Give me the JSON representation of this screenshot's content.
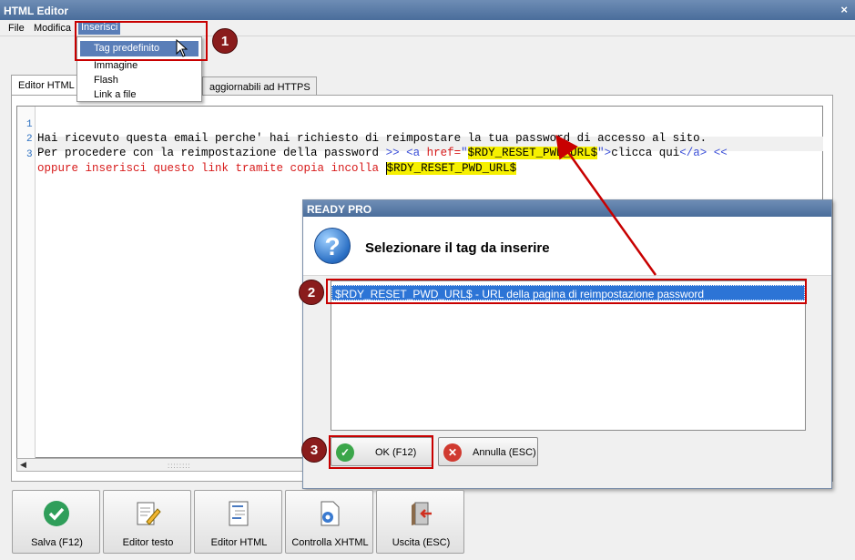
{
  "window": {
    "title": "HTML Editor",
    "close": "×"
  },
  "menubar": {
    "file": "File",
    "modifica": "Modifica",
    "inserisci": "Inserisci"
  },
  "dropdown": {
    "items": [
      "Tag predefinito",
      "Immagine",
      "Flash",
      "Link a file"
    ]
  },
  "tabs": {
    "editor_html": "Editor HTML",
    "partial": "aggiornabili ad HTTPS"
  },
  "code": {
    "line_numbers": [
      "1",
      "2",
      "3"
    ],
    "line1": "Hai ricevuto questa email perche' hai richiesto di reimpostare la tua password di accesso al sito.",
    "line2_text": "Per procedere con la reimpostazione della password ",
    "line2_gt": ">>",
    "line2_tag_open": " <a ",
    "line2_attr": "href=",
    "line2_q1": "\"",
    "line2_value": "$RDY_RESET_PWD_URL$",
    "line2_q2": "\"",
    "line2_gt2": ">",
    "line2_link": "clicca qui",
    "line2_close": "</a>",
    "line2_lt": " <<",
    "line3_text": "oppure inserisci questo link tramite copia incolla ",
    "line3_tag": "$RDY_RESET_PWD_URL$"
  },
  "scrollbar": {
    "left": "◀",
    "right": "▶",
    "grip": "::::::::"
  },
  "dialog": {
    "title": "READY PRO",
    "icon_glyph": "?",
    "heading": "Selezionare il tag da inserire",
    "selected_item": "$RDY_RESET_PWD_URL$ - URL della pagina di reimpostazione password",
    "ok_label": "OK (F12)",
    "cancel_label": "Annulla (ESC)"
  },
  "badges": [
    "1",
    "2",
    "3"
  ],
  "toolbar": {
    "save": "Salva (F12)",
    "text_editor": "Editor testo",
    "html_editor": "Editor HTML",
    "xhtml": "Controlla XHTML",
    "exit": "Uscita (ESC)"
  },
  "colors": {
    "highlight_red": "#c80000",
    "tag_yellow": "#f6f000",
    "selection_blue": "#2c74d6"
  }
}
